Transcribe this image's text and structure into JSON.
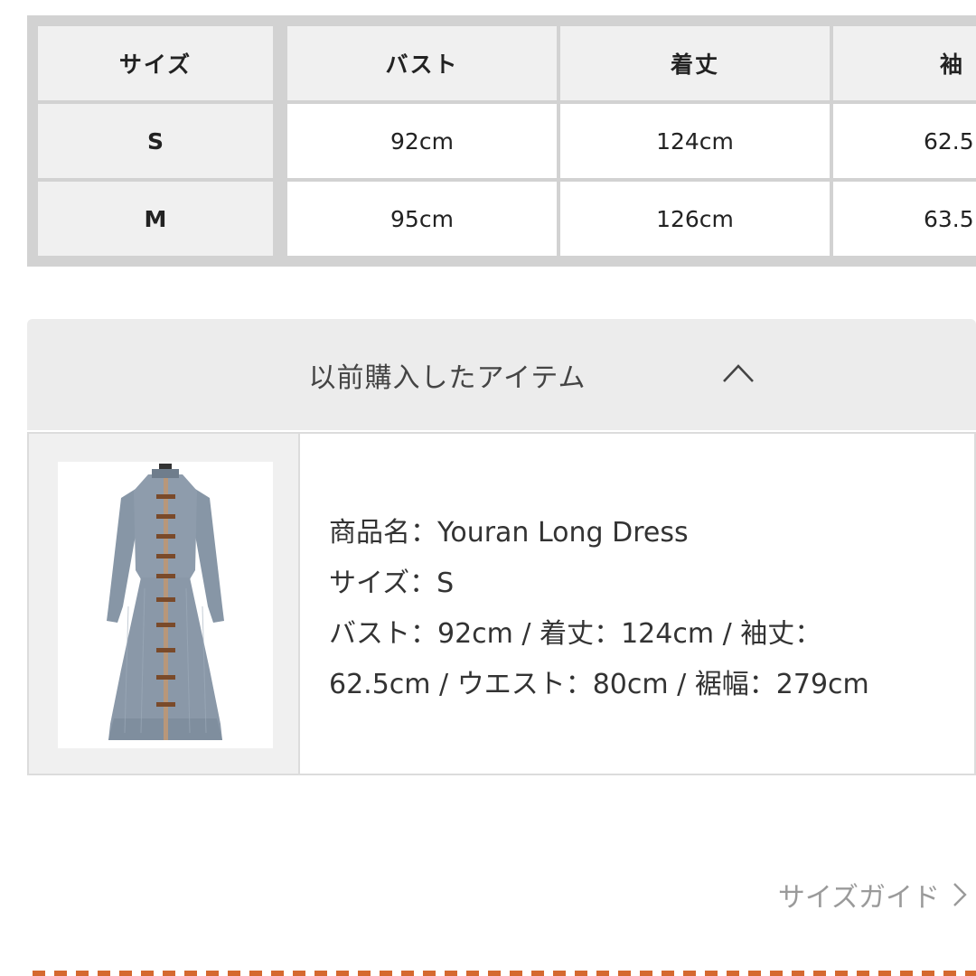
{
  "size_table": {
    "headers": [
      "サイズ",
      "バスト",
      "着丈",
      "袖"
    ],
    "rows": [
      {
        "size": "S",
        "bust": "92cm",
        "length": "124cm",
        "sleeve": "62.5"
      },
      {
        "size": "M",
        "bust": "95cm",
        "length": "126cm",
        "sleeve": "63.5"
      }
    ]
  },
  "previous_items": {
    "title": "以前購入したアイテム",
    "toggle_icon": "chevron-up-icon",
    "item": {
      "image_icon": "long-dress-image",
      "name_line": "商品名：Youran Long Dress",
      "size_line": "サイズ：S",
      "measure_line_1": "バスト：92cm / 着丈：124cm / 袖丈：",
      "measure_line_2": "62.5cm / ウエスト：80cm / 裾幅：279cm"
    }
  },
  "size_guide": {
    "label": "サイズガイド",
    "icon": "chevron-right-icon"
  },
  "colors": {
    "accent_dash": "#d5692f",
    "header_bg": "#ececec",
    "dress_blue_gray": "#8c9bab"
  }
}
